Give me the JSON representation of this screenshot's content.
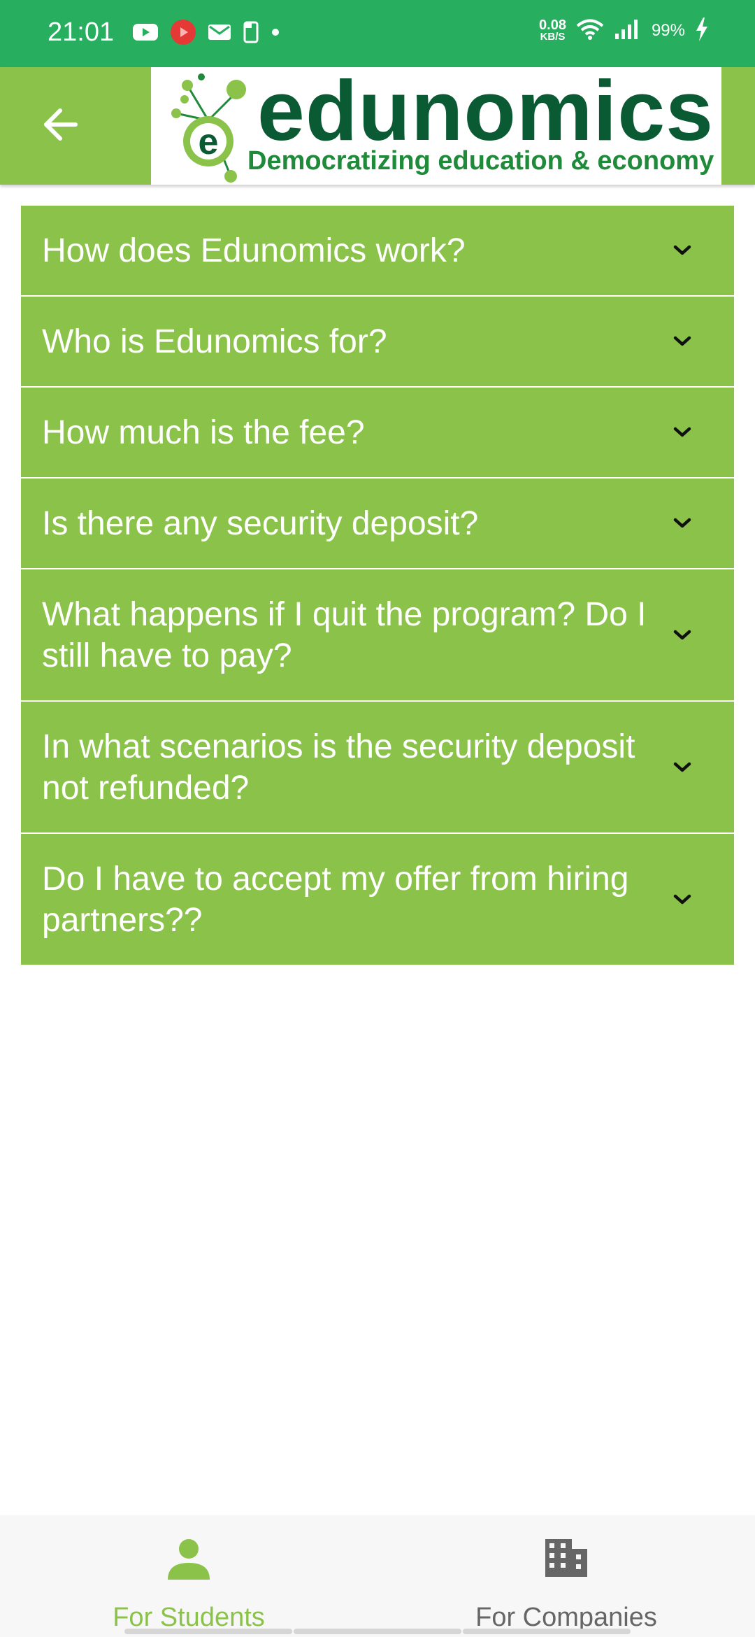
{
  "status_bar": {
    "time": "21:01",
    "net_speed_value": "0.08",
    "net_speed_unit": "KB/S",
    "battery": "99%",
    "notification_icons": [
      "youtube-icon",
      "play-app-icon",
      "mail-icon",
      "phone-outline-icon",
      "dot-icon"
    ]
  },
  "app_bar": {
    "back_icon": "arrow-left-icon",
    "logo_word": "edunomics",
    "logo_tagline": "Democratizing education & economy"
  },
  "faq": {
    "items": [
      {
        "question": "How does Edunomics work?"
      },
      {
        "question": "Who is Edunomics for?"
      },
      {
        "question": "How much is the fee?"
      },
      {
        "question": "Is there any security deposit?"
      },
      {
        "question": "What happens if I quit the program? Do I still have to pay?"
      },
      {
        "question": "In what scenarios is the security deposit not refunded?"
      },
      {
        "question": "Do I have to accept my offer from hiring partners??"
      }
    ],
    "expand_icon": "chevron-down-icon"
  },
  "bottom_nav": {
    "tabs": [
      {
        "label": "For Students",
        "icon": "person-icon",
        "active": true
      },
      {
        "label": "For Companies",
        "icon": "building-icon",
        "active": false
      }
    ]
  },
  "colors": {
    "status_bar": "#27ae5f",
    "accent": "#8bc34a",
    "logo_dark_green": "#0a5a33"
  }
}
